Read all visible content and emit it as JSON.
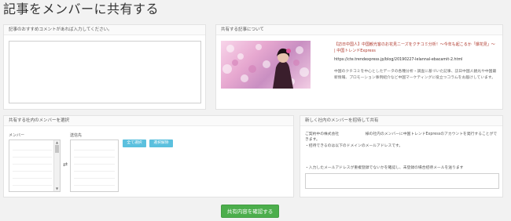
{
  "page": {
    "title": "記事をメンバーに共有する"
  },
  "comment_panel": {
    "label": "記事のおすすめコメントがあれば入力してください。",
    "textarea_value": ""
  },
  "article_panel": {
    "label": "共有する記事について",
    "title": "【訪日中国人】中国観光客のお花見ニーズをクチコミ分析！〜今年も起こるか「爆花見」〜 | 中国トレンドExpress",
    "url": "https://cte.trendexpress.jp/blog/20190227-lelannal-ebacamit-2.html",
    "description": "中国のクチコミを中心としたデータの各種分析・調査に基づいた記事、訪日中国人観光や中国最新情報、プロモーション事例紹介など中国マーケティングに役立つコラムをお届けしています。"
  },
  "members_panel": {
    "label": "共有する社内のメンバーを選択",
    "members_label": "メンバー",
    "dest_label": "送信先",
    "select_all": "全て選択",
    "deselect": "選択解除"
  },
  "new_member_panel": {
    "label": "新しく社内のメンバーを招待して共有",
    "line1": "ご契約中の株式会社　　　　　　　様の社内のメンバーに中国トレンドExpressのアカウントを発行することができます。",
    "line2": "・招待できるのは以下のドメインのメールアドレスです。",
    "line3": "・入力したメールアドレスが重複登録でないかを確認し、未登録の場合招待メールを送ります",
    "email_value": ""
  },
  "footer": {
    "confirm": "共有内容を確認する"
  },
  "colors": {
    "accent_info": "#5bc0de",
    "accent_success": "#4cae4c",
    "article_title": "#b03a2e"
  }
}
